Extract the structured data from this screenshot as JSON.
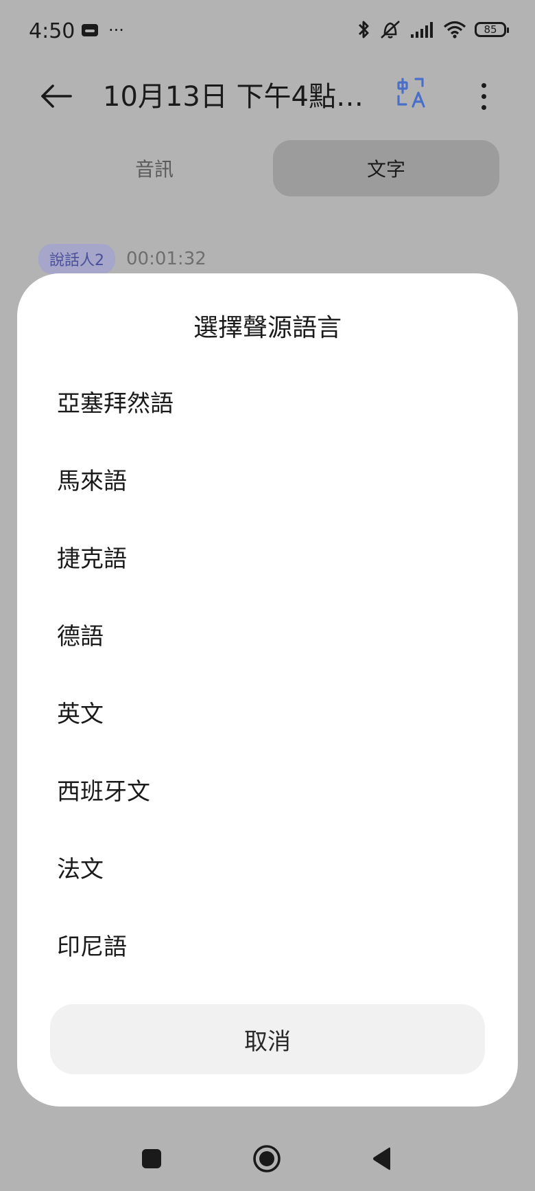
{
  "status_bar": {
    "time": "4:50",
    "dots": "···",
    "battery": "85"
  },
  "app_bar": {
    "title": "10月13日 下午4點1…"
  },
  "tabs": [
    {
      "label": "音訊"
    },
    {
      "label": "文字"
    }
  ],
  "transcript": {
    "speaker": "說話人2",
    "timestamp": "00:01:32"
  },
  "sheet": {
    "title": "選擇聲源語言",
    "languages": [
      {
        "label": "亞塞拜然語"
      },
      {
        "label": "馬來語"
      },
      {
        "label": "捷克語"
      },
      {
        "label": "德語"
      },
      {
        "label": "英文"
      },
      {
        "label": "西班牙文"
      },
      {
        "label": "法文"
      },
      {
        "label": "印尼語"
      }
    ],
    "cancel_label": "取消"
  },
  "icons": {
    "back": "arrow-left-icon",
    "translate": "translate-icon",
    "more": "more-vertical-icon",
    "bluetooth": "bluetooth-icon",
    "mute": "bell-off-icon",
    "signal": "signal-icon",
    "wifi": "wifi-icon"
  },
  "colors": {
    "accent": "#4a6fc9",
    "speaker_badge_bg": "#a5a6c9",
    "speaker_badge_text": "#4a4f9a"
  }
}
